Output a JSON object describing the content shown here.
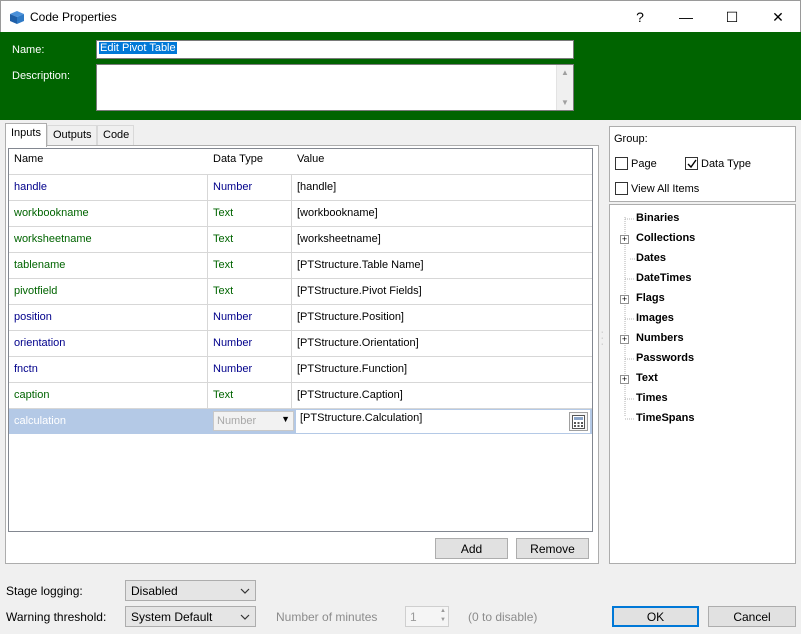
{
  "window": {
    "title": "Code Properties",
    "help_label": "?",
    "minimize_label": "—",
    "maximize_label": "☐",
    "close_label": "✕"
  },
  "header": {
    "name_label": "Name:",
    "name_value": "Edit Pivot Table",
    "description_label": "Description:",
    "description_value": ""
  },
  "tabs": [
    {
      "label": "Inputs",
      "active": true
    },
    {
      "label": "Outputs",
      "active": false
    },
    {
      "label": "Code",
      "active": false
    }
  ],
  "grid": {
    "columns": [
      "Name",
      "Data Type",
      "Value"
    ],
    "rows": [
      {
        "name": "handle",
        "type": "Number",
        "value": "[handle]"
      },
      {
        "name": "workbookname",
        "type": "Text",
        "value": "[workbookname]"
      },
      {
        "name": "worksheetname",
        "type": "Text",
        "value": "[worksheetname]"
      },
      {
        "name": "tablename",
        "type": "Text",
        "value": "[PTStructure.Table Name]"
      },
      {
        "name": "pivotfield",
        "type": "Text",
        "value": "[PTStructure.Pivot Fields]"
      },
      {
        "name": "position",
        "type": "Number",
        "value": "[PTStructure.Position]"
      },
      {
        "name": "orientation",
        "type": "Number",
        "value": "[PTStructure.Orientation]"
      },
      {
        "name": "fnctn",
        "type": "Number",
        "value": "[PTStructure.Function]"
      },
      {
        "name": "caption",
        "type": "Text",
        "value": "[PTStructure.Caption]"
      }
    ],
    "selected_row": {
      "name": "calculation",
      "type": "Number",
      "value": "[PTStructure.Calculation]"
    },
    "add_label": "Add",
    "remove_label": "Remove"
  },
  "group": {
    "label": "Group:",
    "page_label": "Page",
    "page_checked": false,
    "datatype_label": "Data Type",
    "datatype_checked": true,
    "view_all_label": "View All Items",
    "view_all_checked": false
  },
  "tree": [
    {
      "label": "Binaries",
      "expandable": false
    },
    {
      "label": "Collections",
      "expandable": true
    },
    {
      "label": "Dates",
      "expandable": false
    },
    {
      "label": "DateTimes",
      "expandable": false
    },
    {
      "label": "Flags",
      "expandable": true
    },
    {
      "label": "Images",
      "expandable": false
    },
    {
      "label": "Numbers",
      "expandable": true
    },
    {
      "label": "Passwords",
      "expandable": false
    },
    {
      "label": "Text",
      "expandable": true
    },
    {
      "label": "Times",
      "expandable": false
    },
    {
      "label": "TimeSpans",
      "expandable": false
    }
  ],
  "bottom": {
    "stage_logging_label": "Stage logging:",
    "stage_logging_value": "Disabled",
    "warning_threshold_label": "Warning threshold:",
    "warning_threshold_value": "System Default",
    "minutes_label": "Number of minutes",
    "minutes_value": "1",
    "minutes_hint": "(0 to disable)",
    "ok_label": "OK",
    "cancel_label": "Cancel"
  },
  "colors": {
    "header_green": "#006400",
    "number_type": "#00008b",
    "text_type": "#006400",
    "selected_row": "#b4c9e6",
    "ok_border": "#0078d7"
  }
}
